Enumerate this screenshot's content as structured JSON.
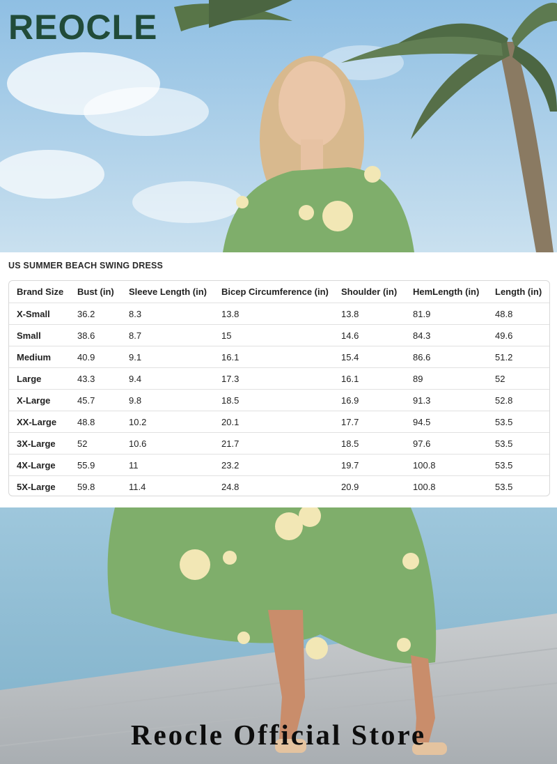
{
  "brand": {
    "logo_text": "REOCLE"
  },
  "chart": {
    "title": "US SUMMER BEACH SWING DRESS",
    "headers": [
      "Brand Size",
      "Bust (in)",
      "Sleeve Length (in)",
      "Bicep Circumference (in)",
      "Shoulder (in)",
      "HemLength (in)",
      "Length (in)"
    ],
    "rows": [
      [
        "X-Small",
        "36.2",
        "8.3",
        "13.8",
        "13.8",
        "81.9",
        "48.8"
      ],
      [
        "Small",
        "38.6",
        "8.7",
        "15",
        "14.6",
        "84.3",
        "49.6"
      ],
      [
        "Medium",
        "40.9",
        "9.1",
        "16.1",
        "15.4",
        "86.6",
        "51.2"
      ],
      [
        "Large",
        "43.3",
        "9.4",
        "17.3",
        "16.1",
        "89",
        "52"
      ],
      [
        "X-Large",
        "45.7",
        "9.8",
        "18.5",
        "16.9",
        "91.3",
        "52.8"
      ],
      [
        "XX-Large",
        "48.8",
        "10.2",
        "20.1",
        "17.7",
        "94.5",
        "53.5"
      ],
      [
        "3X-Large",
        "52",
        "10.6",
        "21.7",
        "18.5",
        "97.6",
        "53.5"
      ],
      [
        "4X-Large",
        "55.9",
        "11",
        "23.2",
        "19.7",
        "100.8",
        "53.5"
      ],
      [
        "5X-Large",
        "59.8",
        "11.4",
        "24.8",
        "20.9",
        "100.8",
        "53.5"
      ]
    ]
  },
  "footer": {
    "store_text": "Reocle Official Store"
  },
  "colors": {
    "sky": "#a9cde8",
    "sea": "#9cc2d6",
    "dress_green": "#7fae6b",
    "logo_green": "#214b39"
  }
}
